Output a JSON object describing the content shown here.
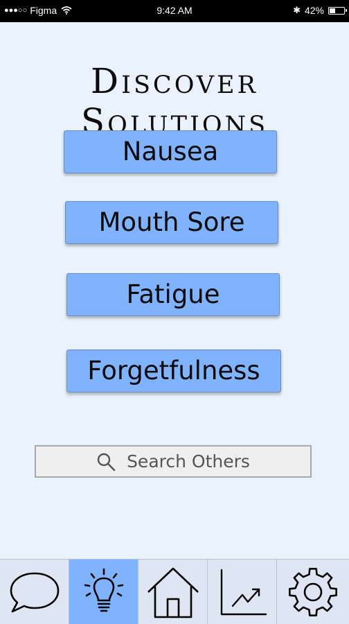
{
  "status_bar": {
    "signal": "●●●○○",
    "carrier": "Figma",
    "time": "9:42 AM",
    "bluetooth": "✱",
    "battery_percent": "42%",
    "battery_level": 0.42
  },
  "page": {
    "title": "Discover Solutions"
  },
  "symptoms": [
    {
      "label": "Nausea"
    },
    {
      "label": "Mouth Sore"
    },
    {
      "label": "Fatigue"
    },
    {
      "label": "Forgetfulness"
    }
  ],
  "search": {
    "placeholder": "Search Others",
    "icon": "search-icon"
  },
  "tabs": [
    {
      "icon": "chat-bubble-icon",
      "active": false
    },
    {
      "icon": "lightbulb-icon",
      "active": true
    },
    {
      "icon": "home-icon",
      "active": false
    },
    {
      "icon": "trend-chart-icon",
      "active": false
    },
    {
      "icon": "gear-icon",
      "active": false
    }
  ],
  "colors": {
    "background": "#eaf2fd",
    "button": "#7fb3fe",
    "active_tab": "#7fb3fe",
    "status_bar": "#000000"
  }
}
